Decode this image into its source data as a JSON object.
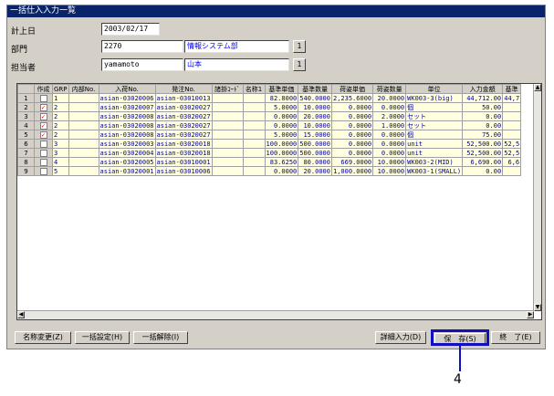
{
  "window": {
    "title": "一括仕入入力一覧"
  },
  "form": {
    "date_label": "計上日",
    "date_value": "2003/02/17",
    "dept_label": "部門",
    "dept_code": "2270",
    "dept_name": "情報システム部",
    "person_label": "担当者",
    "person_code": "yamamoto",
    "person_name": "山本",
    "pick_label": "1"
  },
  "grid": {
    "columns": [
      "",
      "作成",
      "GRP",
      "内部No.",
      "入荷No.",
      "発注No.",
      "諸掛ｺｰﾄﾞ",
      "名称1",
      "基準単価",
      "基準数量",
      "荷姿単価",
      "荷姿数量",
      "単位",
      "入力金額",
      "基準"
    ],
    "rows": [
      {
        "n": "1",
        "check": "",
        "grp": "1",
        "inner": "",
        "arrival": "asian-03020006",
        "order": "asian-03010013",
        "fee": "",
        "name": "",
        "unit_price": "82.8000",
        "qty": "540.0000",
        "pack_price": "2,235.6000",
        "pack_qty": "20.0000",
        "unit": "WK003-3(big)",
        "amount": "44,712.00",
        "base": "44,7"
      },
      {
        "n": "2",
        "check": "✓",
        "grp": "2",
        "inner": "",
        "arrival": "asian-03020007",
        "order": "asian-03020027",
        "fee": "",
        "name": "",
        "unit_price": "5.0000",
        "qty": "10.0000",
        "pack_price": "0.0000",
        "pack_qty": "0.0000",
        "unit": "個",
        "amount": "50.00",
        "base": ""
      },
      {
        "n": "3",
        "check": "✓",
        "grp": "2",
        "inner": "",
        "arrival": "asian-03020008",
        "order": "asian-03020027",
        "fee": "",
        "name": "",
        "unit_price": "0.0000",
        "qty": "20.0000",
        "pack_price": "0.0000",
        "pack_qty": "2.0000",
        "unit": "セット",
        "amount": "0.00",
        "base": ""
      },
      {
        "n": "4",
        "check": "✓",
        "grp": "2",
        "inner": "",
        "arrival": "asian-03020008",
        "order": "asian-03020027",
        "fee": "",
        "name": "",
        "unit_price": "0.0000",
        "qty": "10.0000",
        "pack_price": "0.0000",
        "pack_qty": "1.0000",
        "unit": "セット",
        "amount": "0.00",
        "base": ""
      },
      {
        "n": "5",
        "check": "✓",
        "grp": "2",
        "inner": "",
        "arrival": "asian-03020008",
        "order": "asian-03020027",
        "fee": "",
        "name": "",
        "unit_price": "5.0000",
        "qty": "15.0000",
        "pack_price": "0.0000",
        "pack_qty": "0.0000",
        "unit": "個",
        "amount": "75.00",
        "base": ""
      },
      {
        "n": "6",
        "check": "",
        "grp": "3",
        "inner": "",
        "arrival": "asian-03020003",
        "order": "asian-03020018",
        "fee": "",
        "name": "",
        "unit_price": "100.0000",
        "qty": "500.0000",
        "pack_price": "0.0000",
        "pack_qty": "0.0000",
        "unit": "unit",
        "amount": "52,500.00",
        "base": "52,5"
      },
      {
        "n": "7",
        "check": "",
        "grp": "3",
        "inner": "",
        "arrival": "asian-03020004",
        "order": "asian-03020018",
        "fee": "",
        "name": "",
        "unit_price": "100.0000",
        "qty": "500.0000",
        "pack_price": "0.0000",
        "pack_qty": "0.0000",
        "unit": "unit",
        "amount": "52,500.00",
        "base": "52,5"
      },
      {
        "n": "8",
        "check": "",
        "grp": "4",
        "inner": "",
        "arrival": "asian-03020005",
        "order": "asian-03010001",
        "fee": "",
        "name": "",
        "unit_price": "83.6250",
        "qty": "80.0000",
        "pack_price": "669.0000",
        "pack_qty": "10.0000",
        "unit": "WK003-2(MID)",
        "amount": "6,690.00",
        "base": "6,6"
      },
      {
        "n": "9",
        "check": "",
        "grp": "5",
        "inner": "",
        "arrival": "asian-03020001",
        "order": "asian-03010006",
        "fee": "",
        "name": "",
        "unit_price": "0.0000",
        "qty": "20.0000",
        "pack_price": "1,000.0000",
        "pack_qty": "10.0000",
        "unit": "WK003-1(SMALL)",
        "amount": "0.00",
        "base": ""
      }
    ]
  },
  "buttons": {
    "rename": "名称変更(Z)",
    "bulk_set": "一括設定(H)",
    "bulk_clear": "一括解除(I)",
    "detail": "詳細入力(D)",
    "save": "保　存(S)",
    "close": "終　了(E)"
  },
  "callout": {
    "number": "4"
  },
  "colors": {
    "title_bar": "#0a246a",
    "highlight": "#1010c0",
    "cell_bg": "#ffffe0"
  }
}
